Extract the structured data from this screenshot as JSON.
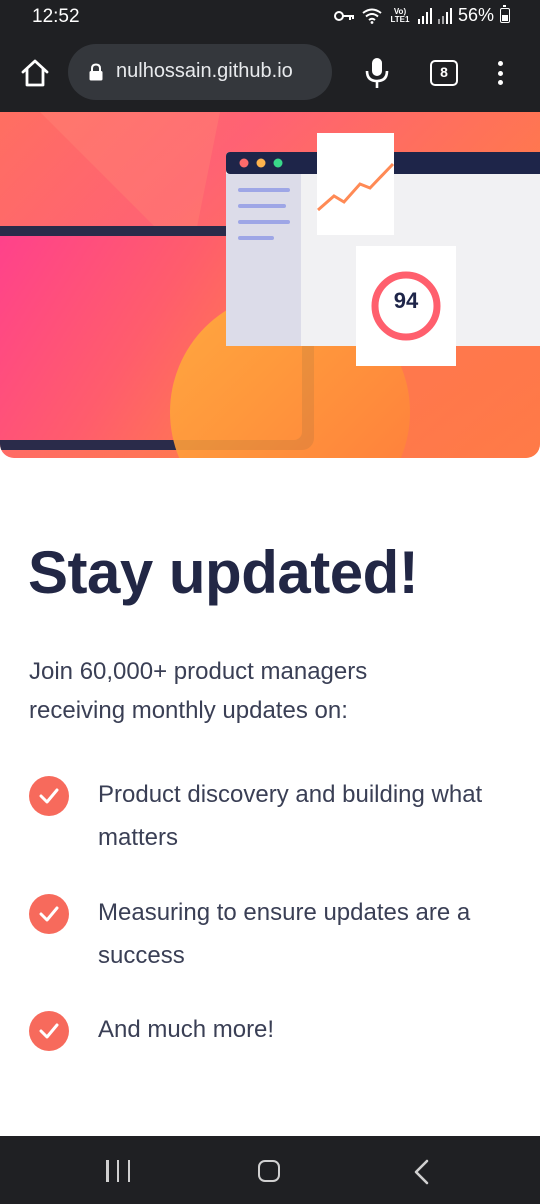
{
  "status_bar": {
    "time": "12:52",
    "network_label": "Vo) LTE1",
    "battery": "56%"
  },
  "browser": {
    "url": "nulhossain.github.io",
    "tab_count": "8"
  },
  "hero": {
    "score": "94",
    "colors": {
      "accent": "#f76a5c",
      "navy": "#1e2549",
      "orange": "#ff8a3d",
      "pink": "#ff4f8a"
    }
  },
  "content": {
    "heading": "Stay updated!",
    "intro": "Join 60,000+ product managers receiving monthly updates on:",
    "benefits": [
      "Product discovery and building what matters",
      "Measuring to ensure updates are a success",
      "And much more!"
    ]
  },
  "icons": [
    "home-icon",
    "lock-icon",
    "mic-icon",
    "tabs-icon",
    "more-vert-icon",
    "check-icon",
    "key-icon",
    "wifi-icon",
    "signal-icon",
    "battery-icon"
  ]
}
